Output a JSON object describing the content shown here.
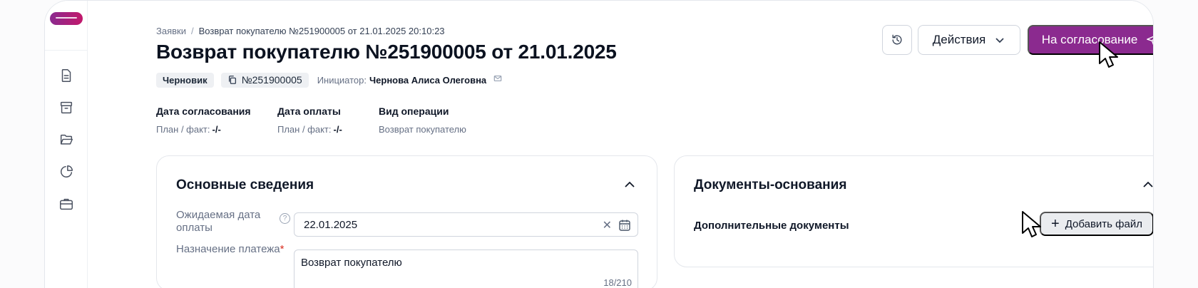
{
  "sidebar": {
    "items": [
      {
        "icon": "document-icon"
      },
      {
        "icon": "archive-icon"
      },
      {
        "icon": "folder-open-icon"
      },
      {
        "icon": "pie-chart-icon"
      },
      {
        "icon": "briefcase-icon"
      }
    ]
  },
  "breadcrumb": {
    "root": "Заявки",
    "separator": "/",
    "current": "Возврат покупателю №251900005 от 21.01.2025 20:10:23"
  },
  "page": {
    "title": "Возврат покупателю №251900005 от 21.01.2025",
    "status": "Черновик",
    "number": "№251900005",
    "initiator_label": "Инициатор:",
    "initiator_name": "Чернова Алиса Олеговна"
  },
  "info": [
    {
      "label": "Дата согласования",
      "sub_label": "План / факт:",
      "sub_value": "-/-"
    },
    {
      "label": "Дата оплаты",
      "sub_label": "План / факт:",
      "sub_value": "-/-"
    },
    {
      "label": "Вид операции",
      "sub_label": "Возврат покупателю",
      "sub_value": ""
    }
  ],
  "toolbar": {
    "actions_label": "Действия",
    "submit_label": "На согласование"
  },
  "main_card": {
    "title": "Основные сведения",
    "expected_date_label": "Ожидаемая дата оплаты",
    "expected_date_value": "22.01.2025",
    "purpose_label": "Назначение платежа",
    "purpose_required": "*",
    "purpose_value": "Возврат покупателю",
    "purpose_counter": "18/210"
  },
  "docs_card": {
    "title": "Документы-основания",
    "additional_label": "Дополнительные документы",
    "add_file_label": "Добавить файл"
  },
  "colors": {
    "accent": "#8b2a8f",
    "required": "#d92d20"
  }
}
